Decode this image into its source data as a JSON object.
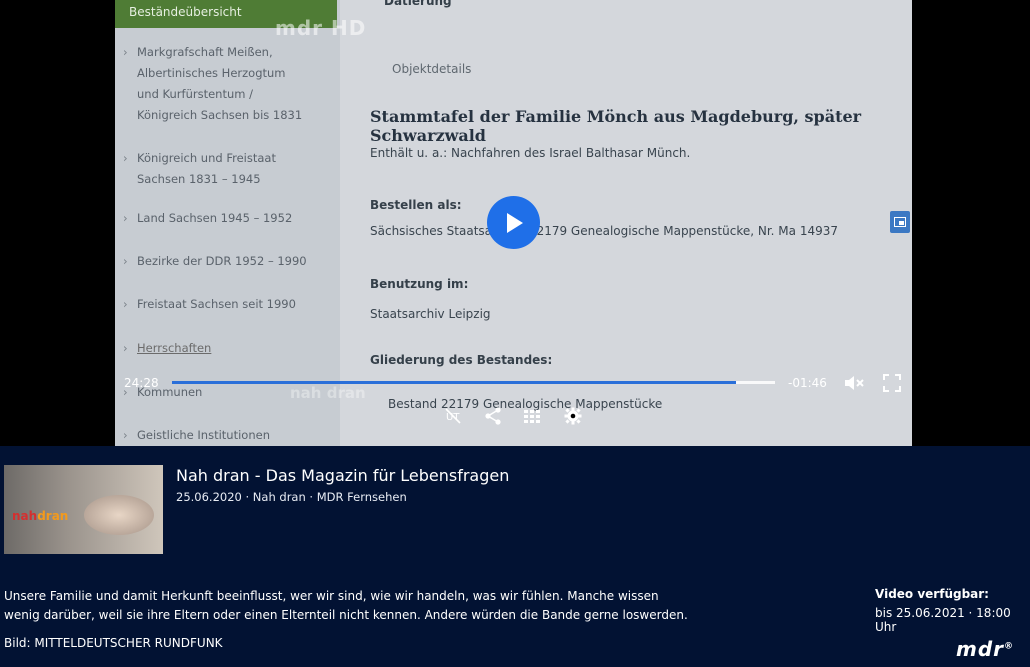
{
  "video_frame": {
    "sidebar": {
      "header": "Beständeübersicht",
      "items": [
        "Markgrafschaft Meißen, Albertinisches Herzogtum und Kurfürstentum / Königreich Sachsen bis 1831",
        "Königreich und Freistaat Sachsen 1831 – 1945",
        "Land Sachsen 1945 – 1952",
        "Bezirke der DDR 1952 – 1990",
        "Freistaat Sachsen seit 1990",
        "Herrschaften",
        "Kommunen",
        "Geistliche Institutionen"
      ]
    },
    "content": {
      "datierung": "Datierung",
      "objektdetails": "Objektdetails",
      "heading": "Stammtafel der Familie Mönch aus Magdeburg, später Schwarzwald",
      "enthaelt": "Enthält u. a.: Nachfahren des Israel Balthasar Münch.",
      "bestellen_label": "Bestellen als:",
      "bestellen_value": "Sächsisches Staatsarchiv, 22179 Genealogische Mappenstücke, Nr. Ma 14937",
      "benutzung_label": "Benutzung im:",
      "benutzung_value": "Staatsarchiv Leipzig",
      "gliederung_label": "Gliederung des Bestandes:",
      "gliederung_value": "Bestand 22179 Genealogische Mappenstücke"
    },
    "watermark": "mdr HD",
    "program_watermark": "nah dran"
  },
  "player": {
    "current_time": "24:28",
    "remaining_time": "-01:46",
    "progress_fraction": 0.935,
    "icons": [
      "play-icon",
      "mute-icon",
      "fullscreen-icon",
      "subtitles-off-icon",
      "share-icon",
      "chapters-icon",
      "settings-icon"
    ],
    "accent_color": "#1f6fe8"
  },
  "info": {
    "title": "Nah dran - Das Magazin für Lebensfragen",
    "meta": "25.06.2020 · Nah dran · MDR Fernsehen",
    "thumbnail_logo_a": "nah",
    "thumbnail_logo_b": "dran",
    "description": "Unsere Familie und damit Herkunft beeinflusst, wer wir sind, wie wir handeln, was wir fühlen. Manche wissen wenig darüber, weil sie ihre Eltern oder einen Elternteil nicht kennen. Andere würden die Bande gerne loswerden.",
    "availability_label": "Video verfügbar:",
    "availability_value": "bis 25.06.2021 · 18:00 Uhr",
    "credit": "Bild: MITTELDEUTSCHER RUNDFUNK",
    "logo": "mdr",
    "background_color": "#021233"
  }
}
